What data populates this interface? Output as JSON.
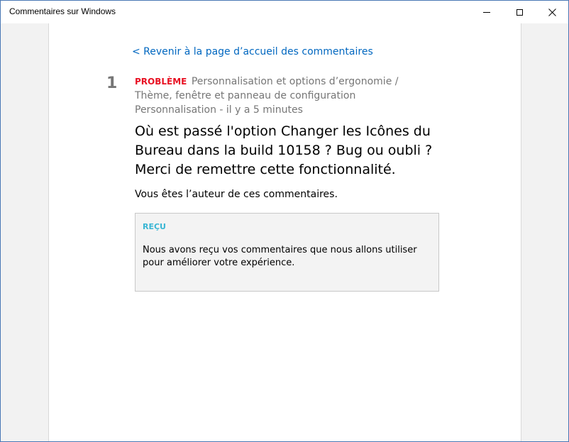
{
  "window": {
    "title": "Commentaires sur Windows",
    "controls": {
      "minimize_icon": "minimize-icon",
      "maximize_icon": "maximize-icon",
      "close_icon": "close-icon"
    }
  },
  "content": {
    "back_link": "< Revenir à la page d’accueil des commentaires",
    "item_number": "1",
    "issue_tag": "PROBLÈME",
    "category": "Personnalisation et options d’ergonomie / Thème, fenêtre et panneau de configuration Personnalisation - il y a 5 minutes",
    "headline": "Où est passé l'option Changer les Icônes du Bureau dans la build 10158 ? Bug ou oubli ? Merci de remettre cette fonctionnalité.",
    "author_note": "Vous êtes l’auteur de ces commentaires.",
    "status": {
      "label": "REÇU",
      "message": "Nous avons reçu vos commentaires que nous allons utiliser pour améliorer votre expérience."
    }
  },
  "colors": {
    "link": "#0067c0",
    "issue_tag": "#e81123",
    "status_label": "#38b6d4",
    "muted_text": "#767676"
  }
}
